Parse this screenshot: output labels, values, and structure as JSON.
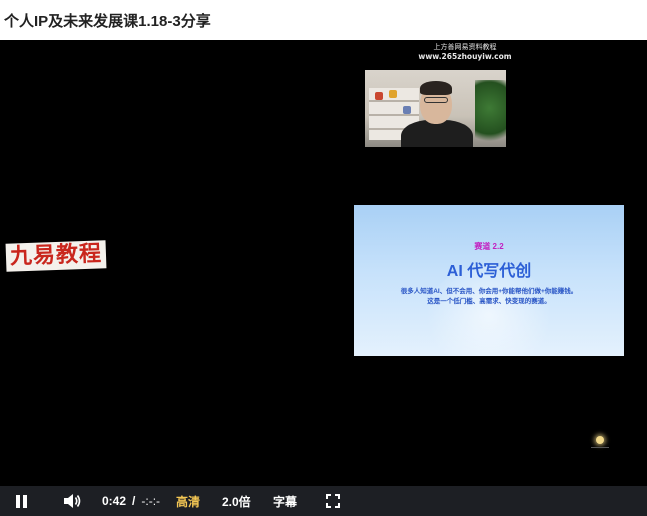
{
  "title": "个人IP及未来发展课1.18-3分享",
  "video": {
    "watermark_line1": "上方善网易资料教程",
    "watermark_line2": "www.265zhouyiw.com",
    "logo_text": "九易教程",
    "slide": {
      "tag": "赛道 2.2",
      "heading": "AI 代写代创",
      "body_line1": "很多人知道AI、但不会用、你会用+你能帮他们做+你能赚钱。",
      "body_line2": "这是一个低门槛、高需求、快变现的赛道。"
    }
  },
  "controls": {
    "current_time": "0:42",
    "separator": "/",
    "duration": "-:-:-",
    "quality_label": "高清",
    "speed_label": "2.0倍",
    "subtitle_label": "字幕",
    "icons": [
      "pause-icon",
      "volume-icon",
      "fullscreen-icon"
    ],
    "accent_color": "#f3c654"
  }
}
